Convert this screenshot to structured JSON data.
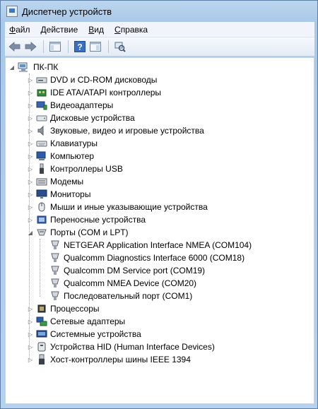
{
  "window": {
    "title": "Диспетчер устройств"
  },
  "menu": [
    {
      "label": "Файл",
      "accel": "Ф",
      "rest": "айл"
    },
    {
      "label": "Действие",
      "accel": "Д",
      "rest": "ействие"
    },
    {
      "label": "Вид",
      "accel": "В",
      "rest": "ид"
    },
    {
      "label": "Справка",
      "accel": "С",
      "rest": "правка"
    }
  ],
  "tree": {
    "root": "ПК-ПК",
    "categories": [
      {
        "label": "DVD и CD-ROM дисководы",
        "icon": "dvd-drive-icon",
        "expanded": false
      },
      {
        "label": "IDE ATA/ATAPI контроллеры",
        "icon": "ide-controller-icon",
        "expanded": false
      },
      {
        "label": "Видеоадаптеры",
        "icon": "display-adapter-icon",
        "expanded": false
      },
      {
        "label": "Дисковые устройства",
        "icon": "disk-drive-icon",
        "expanded": false
      },
      {
        "label": "Звуковые, видео и игровые устройства",
        "icon": "speaker-icon",
        "expanded": false
      },
      {
        "label": "Клавиатуры",
        "icon": "keyboard-icon",
        "expanded": false
      },
      {
        "label": "Компьютер",
        "icon": "computer-icon",
        "expanded": false
      },
      {
        "label": "Контроллеры USB",
        "icon": "usb-icon",
        "expanded": false
      },
      {
        "label": "Модемы",
        "icon": "modem-icon",
        "expanded": false
      },
      {
        "label": "Мониторы",
        "icon": "monitor-icon",
        "expanded": false
      },
      {
        "label": "Мыши и иные указывающие устройства",
        "icon": "mouse-icon",
        "expanded": false
      },
      {
        "label": "Переносные устройства",
        "icon": "portable-device-icon",
        "expanded": false
      },
      {
        "label": "Порты (COM и LPT)",
        "icon": "port-icon",
        "expanded": true,
        "children": [
          "NETGEAR Application Interface NMEA (COM104)",
          "Qualcomm Diagnostics Interface 6000 (COM18)",
          "Qualcomm DM Service port (COM19)",
          "Qualcomm NMEA Device (COM20)",
          "Последовательный порт (COM1)"
        ]
      },
      {
        "label": "Процессоры",
        "icon": "processor-icon",
        "expanded": false
      },
      {
        "label": "Сетевые адаптеры",
        "icon": "network-adapter-icon",
        "expanded": false
      },
      {
        "label": "Системные устройства",
        "icon": "system-device-icon",
        "expanded": false
      },
      {
        "label": "Устройства HID (Human Interface Devices)",
        "icon": "hid-icon",
        "expanded": false
      },
      {
        "label": "Хост-контроллеры шины IEEE 1394",
        "icon": "ieee1394-icon",
        "expanded": false
      }
    ]
  },
  "colors": {
    "accent": "#3a78c8",
    "chrome": "#a9c8e8"
  }
}
